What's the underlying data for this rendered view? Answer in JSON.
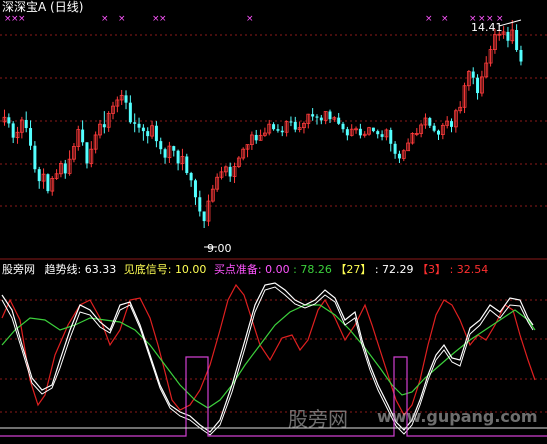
{
  "title": "深深宝A (日线)",
  "price_panel": {
    "high_label": "14.41",
    "low_label": "9.00",
    "high_arrow": "↙",
    "low_arrow": "←"
  },
  "indicator_bar": {
    "source": "股旁网",
    "trend_label": "趋势线:",
    "trend_value": "63.33",
    "bottom_label": "见底信号:",
    "bottom_value": "10.00",
    "buy_label": "买点准备:",
    "buy_value": "0.00",
    "green_value": ": 78.26",
    "bracket27": "【27】",
    "val27": ": 72.29",
    "bracket3": "【3】",
    "val3": ": 32.54"
  },
  "watermark": {
    "cn": "股旁网",
    "url": "www.gupang.com"
  },
  "colors": {
    "bg": "#000000",
    "up_candle": "#ff3b3b",
    "down_candle": "#54ffff",
    "grid": "#8b1a1a",
    "marker": "#ff55ff",
    "line_white": "#ffffff",
    "line_green": "#3cd03c",
    "line_red": "#e02020",
    "line_magenta": "#d040d0"
  },
  "chart_data": {
    "type": "candlestick",
    "title": "深深宝A (日线)",
    "y_annotations": [
      {
        "label": "14.41",
        "value": 14.41
      },
      {
        "label": "9.00",
        "value": 9.0
      }
    ],
    "candles": [
      [
        11.76,
        11.88,
        12.08,
        11.66
      ],
      [
        11.88,
        11.72,
        11.98,
        11.61
      ],
      [
        11.72,
        11.35,
        11.78,
        11.21
      ],
      [
        11.35,
        11.49,
        11.63,
        11.19
      ],
      [
        11.49,
        11.81,
        11.89,
        11.33
      ],
      [
        11.81,
        11.6,
        12.03,
        11.49
      ],
      [
        11.6,
        11.14,
        11.8,
        11.03
      ],
      [
        11.14,
        10.53,
        11.26,
        10.44
      ],
      [
        10.53,
        10.22,
        10.59,
        10.02
      ],
      [
        10.22,
        10.4,
        10.55,
        10.02
      ],
      [
        10.4,
        9.96,
        10.42,
        9.9
      ],
      [
        9.96,
        10.29,
        10.35,
        9.84
      ],
      [
        10.29,
        10.41,
        10.53,
        10.25
      ],
      [
        10.41,
        10.68,
        10.75,
        10.32
      ],
      [
        10.68,
        10.42,
        10.77,
        10.28
      ],
      [
        10.42,
        10.79,
        11.02,
        10.36
      ],
      [
        10.79,
        11.12,
        11.21,
        10.71
      ],
      [
        11.12,
        11.56,
        11.66,
        11.01
      ],
      [
        11.56,
        11.23,
        11.8,
        11.14
      ],
      [
        11.23,
        10.68,
        11.23,
        10.55
      ],
      [
        10.68,
        11.05,
        11.26,
        10.58
      ],
      [
        11.05,
        11.42,
        11.51,
        10.94
      ],
      [
        11.42,
        11.7,
        11.81,
        11.33
      ],
      [
        11.7,
        11.62,
        12.04,
        11.46
      ],
      [
        11.62,
        11.98,
        12.04,
        11.5
      ],
      [
        11.98,
        12.17,
        12.28,
        11.83
      ],
      [
        12.17,
        12.33,
        12.42,
        12.01
      ],
      [
        12.33,
        12.45,
        12.59,
        12.2
      ],
      [
        12.45,
        12.26,
        12.58,
        12.09
      ],
      [
        12.26,
        11.75,
        12.45,
        11.71
      ],
      [
        11.75,
        11.71,
        11.98,
        11.49
      ],
      [
        11.71,
        11.61,
        11.87,
        11.48
      ],
      [
        11.61,
        11.52,
        11.7,
        11.27
      ],
      [
        11.52,
        11.39,
        11.62,
        11.2
      ],
      [
        11.39,
        11.66,
        11.79,
        11.32
      ],
      [
        11.66,
        11.26,
        11.78,
        11.1
      ],
      [
        11.26,
        11.05,
        11.35,
        10.92
      ],
      [
        11.05,
        10.83,
        11.09,
        10.67
      ],
      [
        10.83,
        11.13,
        11.24,
        10.69
      ],
      [
        11.13,
        11.01,
        11.14,
        10.86
      ],
      [
        11.01,
        10.68,
        11.04,
        10.5
      ],
      [
        10.68,
        10.86,
        11.06,
        10.5
      ],
      [
        10.86,
        10.43,
        10.93,
        10.38
      ],
      [
        10.43,
        10.24,
        10.46,
        10.07
      ],
      [
        10.24,
        9.8,
        10.28,
        9.6
      ],
      [
        9.8,
        9.43,
        9.97,
        9.3
      ],
      [
        9.43,
        9.18,
        9.43,
        9.0
      ],
      [
        9.18,
        9.7,
        9.87,
        9.05
      ],
      [
        9.7,
        10.01,
        10.12,
        9.66
      ],
      [
        10.01,
        10.32,
        10.42,
        9.94
      ],
      [
        10.32,
        10.46,
        10.59,
        10.26
      ],
      [
        10.46,
        10.59,
        10.63,
        10.35
      ],
      [
        10.59,
        10.34,
        10.7,
        10.2
      ],
      [
        10.34,
        10.6,
        10.7,
        10.17
      ],
      [
        10.6,
        10.82,
        10.87,
        10.56
      ],
      [
        10.82,
        11.05,
        11.1,
        10.76
      ],
      [
        11.05,
        11.17,
        11.17,
        10.84
      ],
      [
        11.17,
        11.42,
        11.51,
        11.03
      ],
      [
        11.42,
        11.28,
        11.55,
        11.19
      ],
      [
        11.28,
        11.41,
        11.56,
        11.27
      ],
      [
        11.41,
        11.47,
        11.61,
        11.37
      ],
      [
        11.47,
        11.7,
        11.81,
        11.41
      ],
      [
        11.7,
        11.57,
        11.75,
        11.53
      ],
      [
        11.57,
        11.53,
        11.7,
        11.48
      ],
      [
        11.53,
        11.49,
        11.65,
        11.39
      ],
      [
        11.49,
        11.77,
        11.8,
        11.38
      ],
      [
        11.77,
        11.76,
        11.9,
        11.65
      ],
      [
        11.76,
        11.56,
        11.89,
        11.49
      ],
      [
        11.56,
        11.61,
        11.77,
        11.49
      ],
      [
        11.61,
        11.72,
        11.77,
        11.46
      ],
      [
        11.72,
        11.96,
        11.97,
        11.59
      ],
      [
        11.96,
        11.9,
        12.12,
        11.79
      ],
      [
        11.9,
        11.87,
        11.96,
        11.69
      ],
      [
        11.87,
        11.8,
        11.94,
        11.7
      ],
      [
        11.8,
        12.03,
        12.03,
        11.7
      ],
      [
        12.03,
        11.83,
        12.08,
        11.73
      ],
      [
        11.83,
        11.87,
        11.91,
        11.76
      ],
      [
        11.87,
        11.71,
        11.99,
        11.68
      ],
      [
        11.71,
        11.57,
        11.76,
        11.48
      ],
      [
        11.57,
        11.41,
        11.63,
        11.28
      ],
      [
        11.41,
        11.57,
        11.7,
        11.38
      ],
      [
        11.57,
        11.58,
        11.64,
        11.45
      ],
      [
        11.58,
        11.41,
        11.71,
        11.33
      ],
      [
        11.41,
        11.44,
        11.52,
        11.35
      ],
      [
        11.44,
        11.61,
        11.63,
        11.4
      ],
      [
        11.61,
        11.52,
        11.61,
        11.49
      ],
      [
        11.52,
        11.44,
        11.56,
        11.33
      ],
      [
        11.44,
        11.37,
        11.54,
        11.28
      ],
      [
        11.37,
        11.55,
        11.59,
        11.28
      ],
      [
        11.55,
        11.19,
        11.61,
        10.99
      ],
      [
        11.19,
        10.93,
        11.26,
        10.8
      ],
      [
        10.93,
        10.81,
        11.01,
        10.69
      ],
      [
        10.81,
        11.01,
        11.05,
        10.74
      ],
      [
        11.01,
        11.21,
        11.33,
        11.01
      ],
      [
        11.21,
        11.46,
        11.49,
        11.17
      ],
      [
        11.46,
        11.46,
        11.6,
        11.39
      ],
      [
        11.46,
        11.68,
        11.74,
        11.36
      ],
      [
        11.68,
        11.86,
        11.98,
        11.58
      ],
      [
        11.86,
        11.66,
        11.89,
        11.6
      ],
      [
        11.66,
        11.53,
        11.73,
        11.49
      ],
      [
        11.53,
        11.43,
        11.56,
        11.29
      ],
      [
        11.43,
        11.67,
        11.73,
        11.31
      ],
      [
        11.67,
        11.78,
        11.91,
        11.59
      ],
      [
        11.78,
        11.63,
        11.85,
        11.49
      ],
      [
        11.63,
        12.05,
        12.1,
        11.48
      ],
      [
        12.05,
        12.14,
        12.3,
        11.98
      ],
      [
        12.14,
        12.7,
        12.78,
        11.99
      ],
      [
        12.7,
        13.07,
        13.11,
        12.57
      ],
      [
        13.07,
        12.91,
        13.18,
        12.74
      ],
      [
        12.91,
        12.51,
        13.0,
        12.34
      ],
      [
        12.51,
        12.93,
        13.09,
        12.42
      ],
      [
        12.93,
        13.29,
        13.47,
        12.91
      ],
      [
        13.29,
        13.64,
        13.74,
        13.2
      ],
      [
        13.64,
        14.03,
        14.18,
        13.53
      ],
      [
        14.03,
        14.04,
        14.12,
        13.87
      ],
      [
        14.04,
        14.1,
        14.25,
        13.92
      ],
      [
        14.1,
        13.87,
        14.23,
        13.7
      ],
      [
        13.87,
        14.15,
        14.41,
        13.79
      ],
      [
        14.15,
        13.63,
        14.3,
        13.58
      ],
      [
        13.63,
        13.33,
        13.74,
        13.23
      ]
    ]
  }
}
